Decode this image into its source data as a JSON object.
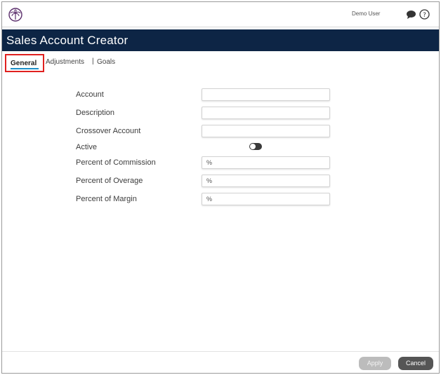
{
  "header": {
    "user_name": "Demo User",
    "logo_icon": "palm-tree-logo-icon",
    "chat_icon": "chat-bubble-icon",
    "help_icon": "help-circle-icon"
  },
  "page": {
    "title": "Sales Account Creator"
  },
  "tabs": {
    "general": "General",
    "adjustments": "Adjustments",
    "separator": "|",
    "goals": "Goals"
  },
  "form": {
    "account": {
      "label": "Account",
      "value": ""
    },
    "description": {
      "label": "Description",
      "value": ""
    },
    "crossover": {
      "label": "Crossover Account",
      "value": ""
    },
    "active": {
      "label": "Active",
      "checked": false
    },
    "commission": {
      "label": "Percent of Commission",
      "value": "%"
    },
    "overage": {
      "label": "Percent of Overage",
      "value": "%"
    },
    "margin": {
      "label": "Percent of Margin",
      "value": "%"
    }
  },
  "footer": {
    "apply_label": "Apply",
    "cancel_label": "Cancel"
  },
  "colors": {
    "titlebar": "#0d2545",
    "highlight": "#e0201f",
    "tab_underline": "#1e90c8"
  }
}
